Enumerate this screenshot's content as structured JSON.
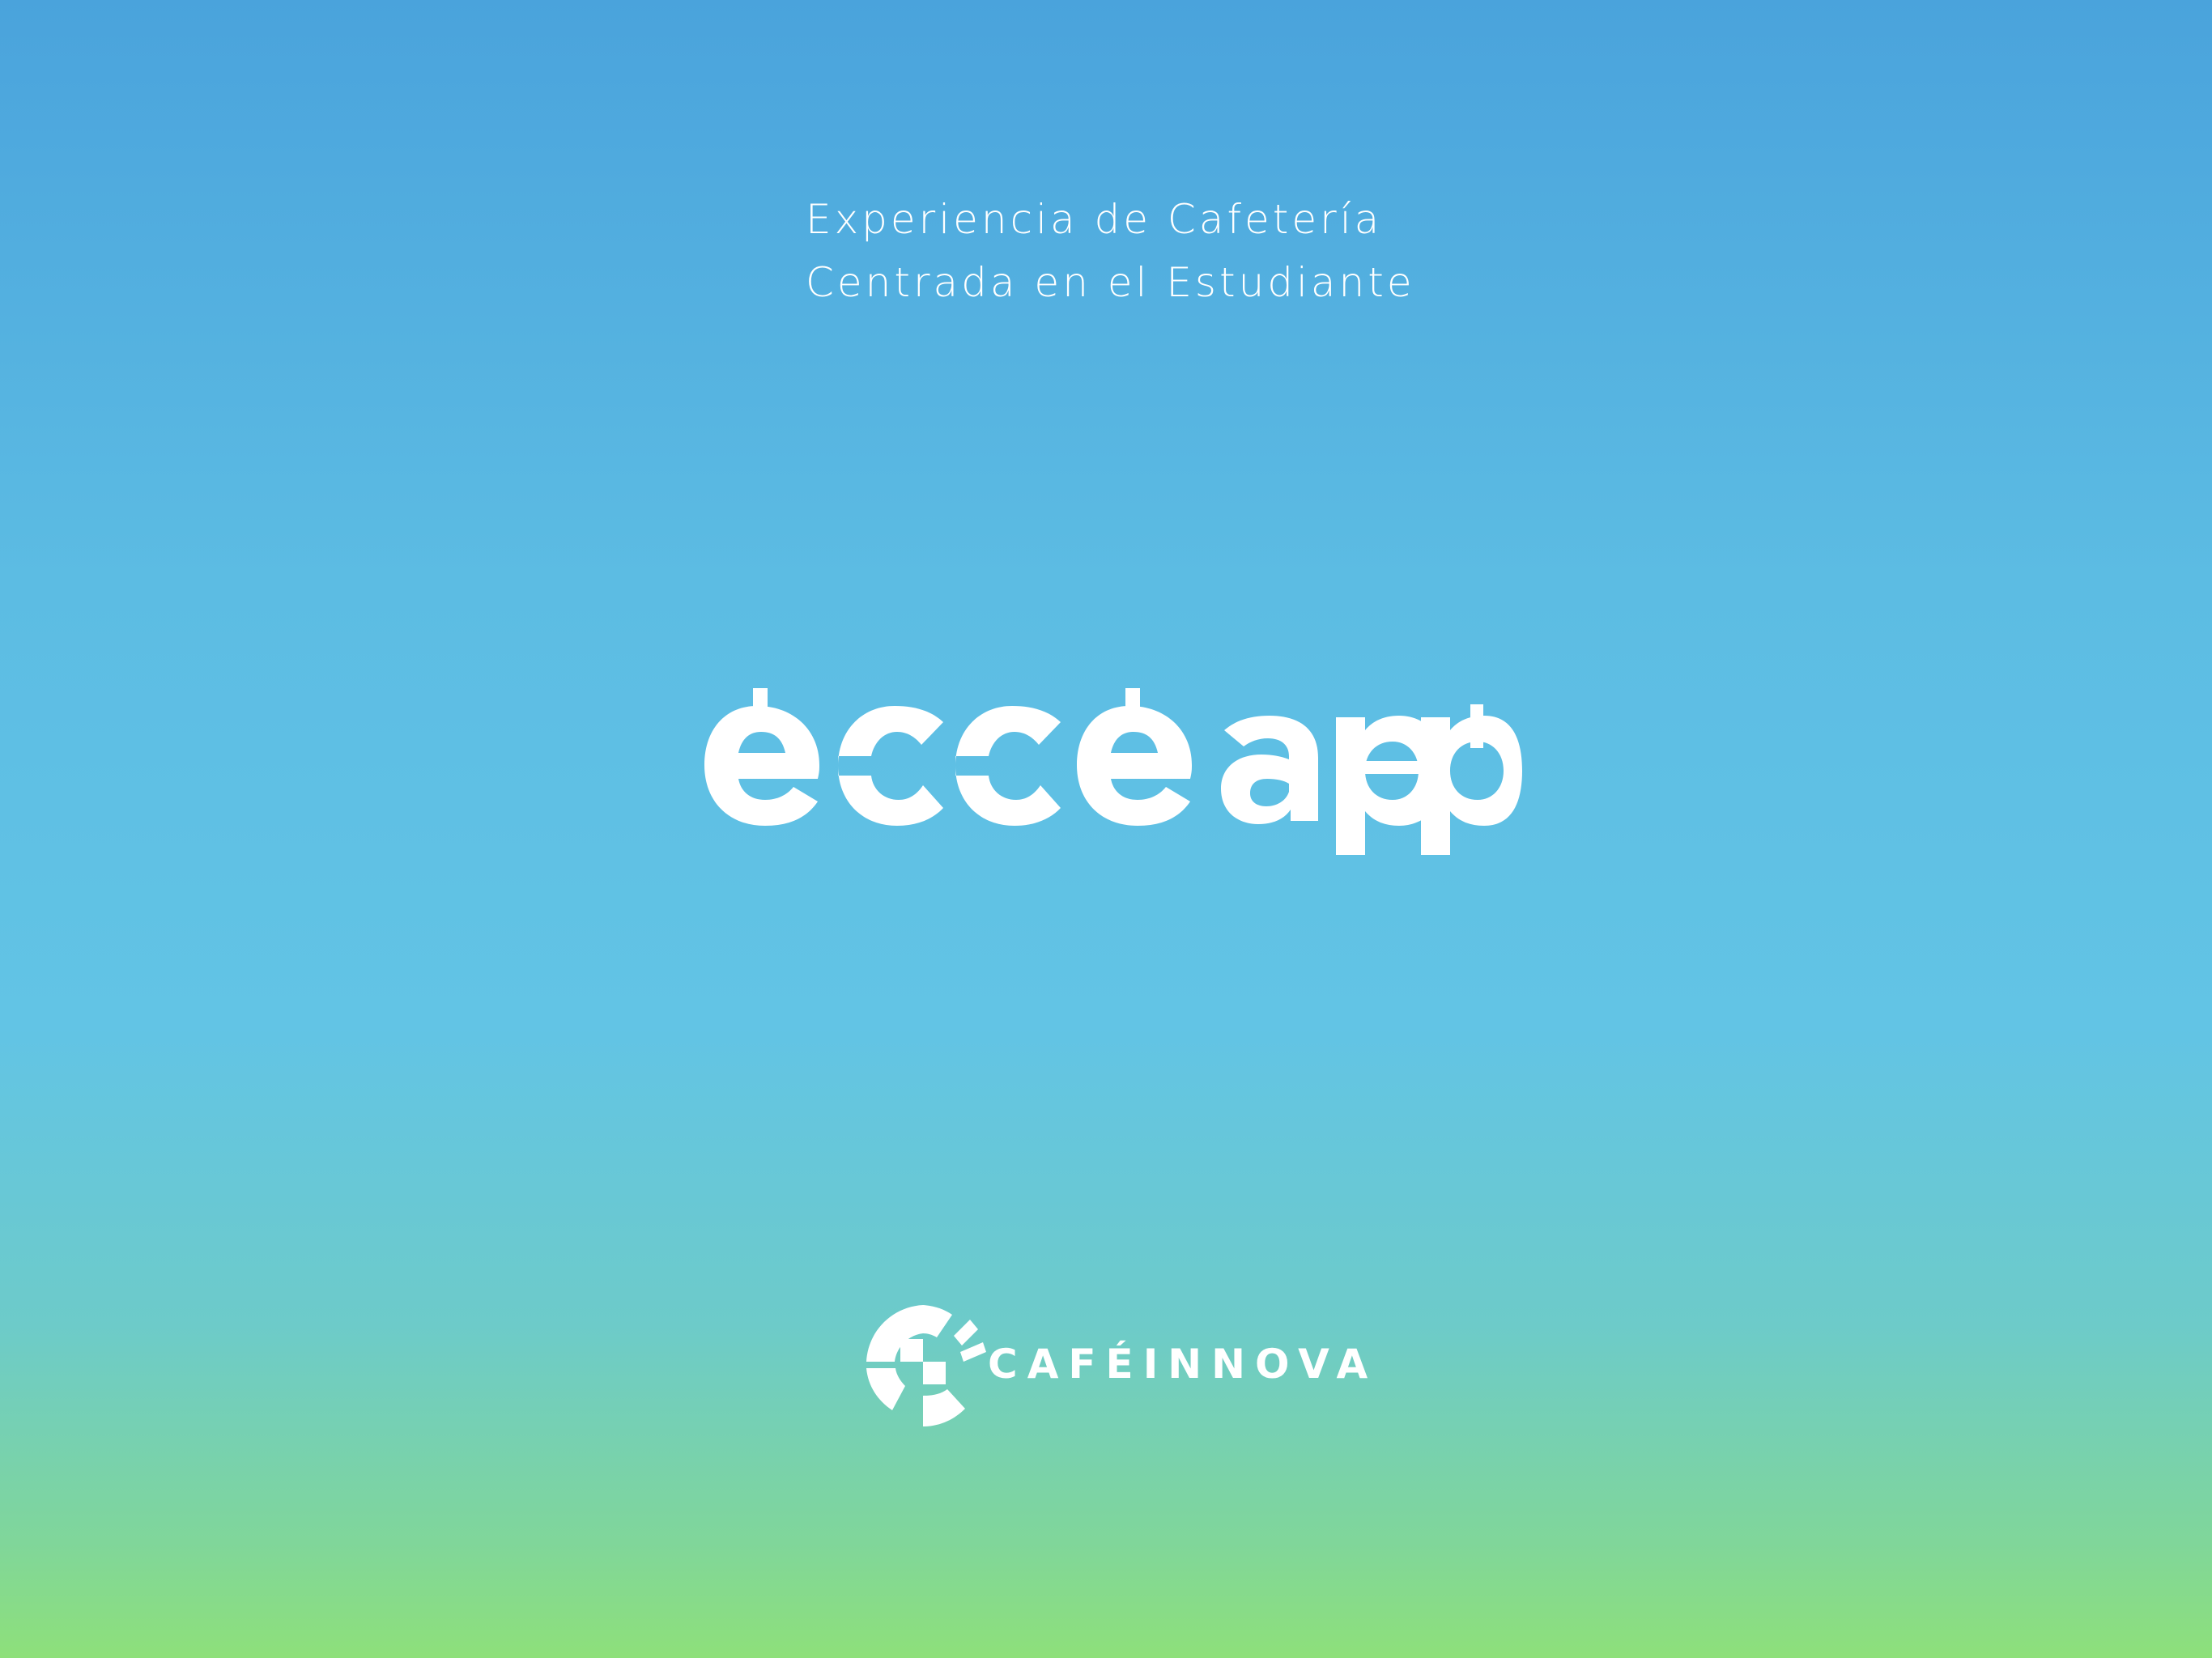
{
  "splash": {
    "tagline_line1": "Experiencia de Cafetería",
    "tagline_line2": "Centrada en el Estudiante",
    "app_logo_text": "ecce app",
    "brand_name": "CAFÉINNOVA"
  },
  "colors": {
    "gradient_top": "#4aa3dc",
    "gradient_mid": "#62c4e5",
    "gradient_bottom": "#8ee07a",
    "foreground": "#ffffff"
  },
  "icons": {
    "app_logo": "ecce-app-logo",
    "brand_mark": "cafeinnova-logo-mark"
  }
}
